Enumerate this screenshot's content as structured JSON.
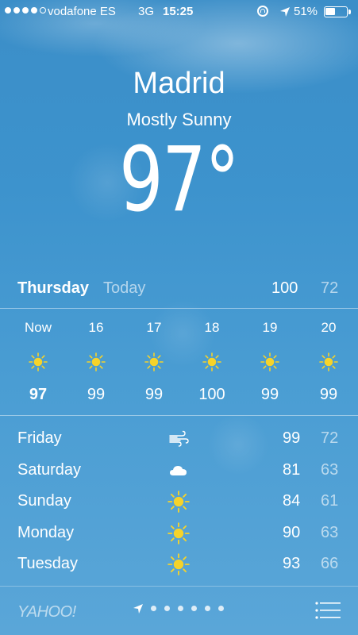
{
  "status_bar": {
    "signal_dots_filled": 4,
    "signal_dots_total": 5,
    "carrier": "vodafone ES",
    "network": "3G",
    "time": "15:25",
    "battery": "51%",
    "battery_fraction": 0.51
  },
  "location": {
    "city": "Madrid",
    "condition": "Mostly Sunny",
    "temperature": "97°"
  },
  "today": {
    "day": "Thursday",
    "label": "Today",
    "high": "100",
    "low": "72"
  },
  "hourly": [
    {
      "label": "Now",
      "icon": "sun-icon",
      "temp": "97"
    },
    {
      "label": "16",
      "icon": "sun-icon",
      "temp": "99"
    },
    {
      "label": "17",
      "icon": "sun-icon",
      "temp": "99"
    },
    {
      "label": "18",
      "icon": "sun-icon",
      "temp": "100"
    },
    {
      "label": "19",
      "icon": "sun-icon",
      "temp": "99"
    },
    {
      "label": "20",
      "icon": "sun-icon",
      "temp": "99"
    }
  ],
  "daily": [
    {
      "day": "Friday",
      "icon": "wind-icon",
      "high": "99",
      "low": "72"
    },
    {
      "day": "Saturday",
      "icon": "cloud-icon",
      "high": "81",
      "low": "63"
    },
    {
      "day": "Sunday",
      "icon": "sun-icon",
      "high": "84",
      "low": "61"
    },
    {
      "day": "Monday",
      "icon": "sun-icon",
      "high": "90",
      "low": "63"
    },
    {
      "day": "Tuesday",
      "icon": "sun-icon",
      "high": "93",
      "low": "66"
    }
  ],
  "footer": {
    "provider": "YAHOO!",
    "page_dots": 6
  },
  "colors": {
    "sun": "#f6d32a",
    "sky": "#3d93cd"
  }
}
